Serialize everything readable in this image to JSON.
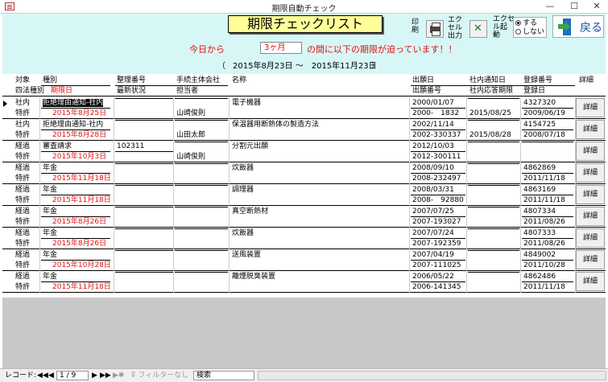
{
  "window": {
    "title": "期限自動チェック",
    "min": "—",
    "max": "☐",
    "close": "✕"
  },
  "header": {
    "title": "期限チェックリスト",
    "print_label": "印\n刷",
    "excel_label": "エク\nセル\n出力",
    "auto_label": "エクセ\nル起\n動",
    "radio_do": "する",
    "radio_dont": "しない",
    "back_label": "戻る",
    "notice_prefix": "今日から",
    "months_value": "3ヶ月",
    "notice_suffix": "の間に以下の期限が迫っています！！",
    "range_open": "（",
    "range_text": "2015年8月23日 ～　2015年11月23日",
    "range_close": "）"
  },
  "columns": {
    "c1a": "対象",
    "c1b": "四法種別",
    "c2a": "種別",
    "c2b": "期限日",
    "c3a": "整理番号",
    "c3b": "最新状況",
    "c4a": "手続主体会社",
    "c4b": "担当者",
    "c5a": "名称",
    "c6a": "出願日",
    "c6b": "出願番号",
    "c7a": "社内通知日",
    "c7b": "社内応答期限",
    "c8a": "登録番号",
    "c8b": "登録日",
    "c9a": "詳細"
  },
  "rows": [
    {
      "target": "社内",
      "law": "特許",
      "kind": "拒絶理由通知-社内",
      "deadline": "2015年8月25日",
      "ref": "",
      "status": "",
      "company": "",
      "person": "山崎俊則",
      "name": "電子機器",
      "app_date": "2000/01/07",
      "app_no": "2000-　1832",
      "notice": "",
      "reply": "2015/08/25",
      "reg_no": "4327320",
      "reg_date": "2009/06/19",
      "detail": "詳細"
    },
    {
      "target": "社内",
      "law": "特許",
      "kind": "拒絶理由通知-社内",
      "deadline": "2015年8月28日",
      "ref": "",
      "status": "",
      "company": "",
      "person": "山田太郎",
      "name": "保温器用断熱体の製造方法",
      "app_date": "2002/11/14",
      "app_no": "2002-330337",
      "notice": "",
      "reply": "2015/08/28",
      "reg_no": "4154725",
      "reg_date": "2008/07/18",
      "detail": "詳細"
    },
    {
      "target": "経過",
      "law": "特許",
      "kind": "審査請求",
      "deadline": "2015年10月3日",
      "ref": "102311",
      "status": "",
      "company": "",
      "person": "山崎俊則",
      "name": "分割元出願",
      "app_date": "2012/10/03",
      "app_no": "2012-300111",
      "notice": "",
      "reply": "",
      "reg_no": "",
      "reg_date": "",
      "detail": "詳細"
    },
    {
      "target": "経過",
      "law": "特許",
      "kind": "年金",
      "deadline": "2015年11月18日",
      "ref": "",
      "status": "",
      "company": "",
      "person": "",
      "name": "炊飯器",
      "app_date": "2008/09/10",
      "app_no": "2008-232497",
      "notice": "",
      "reply": "",
      "reg_no": "4862869",
      "reg_date": "2011/11/18",
      "detail": "詳細"
    },
    {
      "target": "経過",
      "law": "特許",
      "kind": "年金",
      "deadline": "2015年11月18日",
      "ref": "",
      "status": "",
      "company": "",
      "person": "",
      "name": "調理器",
      "app_date": "2008/03/31",
      "app_no": "2008-　92880",
      "notice": "",
      "reply": "",
      "reg_no": "4863169",
      "reg_date": "2011/11/18",
      "detail": "詳細"
    },
    {
      "target": "経過",
      "law": "特許",
      "kind": "年金",
      "deadline": "2015年8月26日",
      "ref": "",
      "status": "",
      "company": "",
      "person": "",
      "name": "真空断熱材",
      "app_date": "2007/07/25",
      "app_no": "2007-193027",
      "notice": "",
      "reply": "",
      "reg_no": "4807334",
      "reg_date": "2011/08/26",
      "detail": "詳細"
    },
    {
      "target": "経過",
      "law": "特許",
      "kind": "年金",
      "deadline": "2015年8月26日",
      "ref": "",
      "status": "",
      "company": "",
      "person": "",
      "name": "炊飯器",
      "app_date": "2007/07/24",
      "app_no": "2007-192359",
      "notice": "",
      "reply": "",
      "reg_no": "4807333",
      "reg_date": "2011/08/26",
      "detail": "詳細"
    },
    {
      "target": "経過",
      "law": "特許",
      "kind": "年金",
      "deadline": "2015年10月28日",
      "ref": "",
      "status": "",
      "company": "",
      "person": "",
      "name": "送風装置",
      "app_date": "2007/04/19",
      "app_no": "2007-111025",
      "notice": "",
      "reply": "",
      "reg_no": "4849002",
      "reg_date": "2011/10/28",
      "detail": "詳細"
    },
    {
      "target": "経過",
      "law": "特許",
      "kind": "年金",
      "deadline": "2015年11月18日",
      "ref": "",
      "status": "",
      "company": "",
      "person": "",
      "name": "離煙脱臭装置",
      "app_date": "2006/05/22",
      "app_no": "2006-141345",
      "notice": "",
      "reply": "",
      "reg_no": "4862486",
      "reg_date": "2011/11/18",
      "detail": "詳細"
    }
  ],
  "statusbar": {
    "record_label": "レコード:",
    "first": "◀◀",
    "prev": "◀",
    "position": "1 / 9",
    "next": "▶",
    "last": "▶▶",
    "new": "▶✱",
    "filter": "フィルターなし",
    "search_placeholder": "検索"
  }
}
